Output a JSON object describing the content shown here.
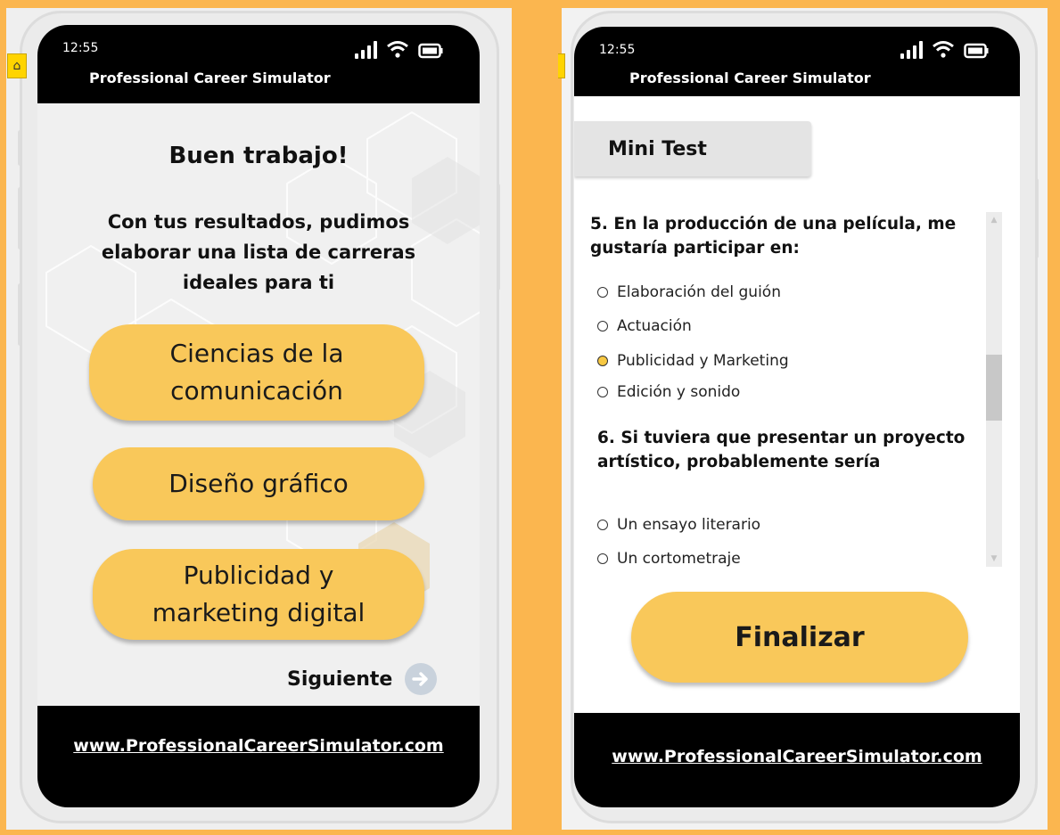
{
  "left_screen": {
    "time": "12:55",
    "app_title": "Professional Career Simulator",
    "heading": "Buen trabajo!",
    "subtext": "Con tus resultados, pudimos elaborar una lista de carreras ideales para ti",
    "careers": [
      {
        "label": "Ciencias de la comunicación"
      },
      {
        "label": "Diseño gráfico"
      },
      {
        "label": "Publicidad y marketing digital"
      }
    ],
    "next_label": "Siguiente",
    "footer_link": "www.ProfessionalCareerSimulator.com"
  },
  "right_screen": {
    "time": "12:55",
    "app_title": "Professional Career Simulator",
    "tab_label": "Mini Test",
    "questions": [
      {
        "text": "5. En la producción de una película, me gustaría participar en:",
        "options": [
          {
            "label": "Elaboración del guión",
            "selected": false
          },
          {
            "label": "Actuación",
            "selected": false
          },
          {
            "label": "Publicidad y Marketing",
            "selected": true
          },
          {
            "label": "Edición y sonido",
            "selected": false
          }
        ]
      },
      {
        "text": "6. Si tuviera que presentar un proyecto artístico, probablemente sería",
        "options": [
          {
            "label": "Un ensayo literario",
            "selected": false
          },
          {
            "label": "Un cortometraje",
            "selected": false
          }
        ]
      }
    ],
    "finish_label": "Finalizar",
    "footer_link": "www.ProfessionalCareerSimulator.com"
  },
  "colors": {
    "background": "#fbb64f",
    "button_yellow": "#f9c85a",
    "header_black": "#000000"
  },
  "icons": [
    "home-icon",
    "signal-icon",
    "wifi-icon",
    "battery-icon",
    "arrow-right-circle-icon",
    "radio-icon"
  ]
}
